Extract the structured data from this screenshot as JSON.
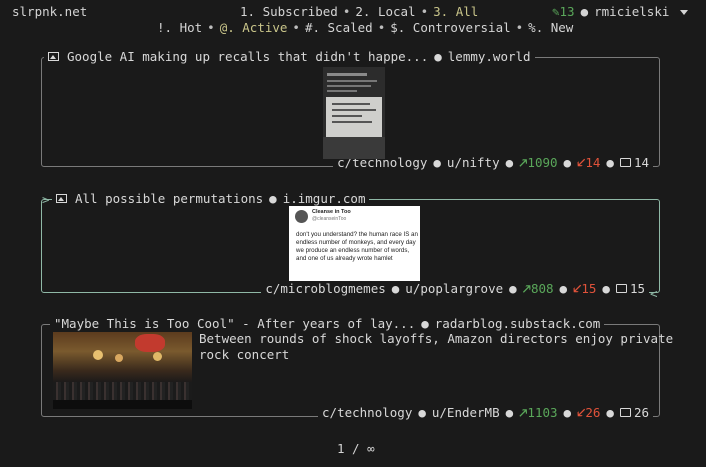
{
  "site": {
    "name": "slrpnk.net"
  },
  "listing_tabs": [
    {
      "label": "1. Subscribed",
      "active": false
    },
    {
      "label": "2. Local",
      "active": false
    },
    {
      "label": "3. All",
      "active": true
    }
  ],
  "sort_tabs": [
    {
      "label": "!. Hot",
      "active": false
    },
    {
      "label": "@. Active",
      "active": true
    },
    {
      "label": "#. Scaled",
      "active": false
    },
    {
      "label": "$. Controversial",
      "active": false
    },
    {
      "label": "%. New",
      "active": false
    }
  ],
  "user": {
    "score": "13",
    "username": "rmicielski",
    "dropdown_icon": "caret-down-icon"
  },
  "posts": [
    {
      "title": "Google AI making up recalls that didn't happe...",
      "domain": "lemmy.world",
      "type_icon": "image-icon",
      "community": "c/technology",
      "author": "u/nifty",
      "upvotes": "1090",
      "downvotes": "14",
      "comments": "14",
      "selected": false
    },
    {
      "title": "All possible permutations",
      "domain": "i.imgur.com",
      "type_icon": "image-icon",
      "community": "c/microblogmemes",
      "author": "u/poplargrove",
      "upvotes": "808",
      "downvotes": "15",
      "comments": "15",
      "selected": true,
      "thumbnail": {
        "name": "Cleanse in Too",
        "handle": "@cleanseinToo",
        "text": "don't you understand? the human race IS an endless number of monkeys, and every day we produce an endless number of words, and one of us already wrote hamlet"
      }
    },
    {
      "title": "\"Maybe This is Too Cool\" - After years of lay...",
      "domain": "radarblog.substack.com",
      "type_icon": "link-icon",
      "excerpt_line1": "Between rounds of shock layoffs, Amazon directors enjoy private",
      "excerpt_line2": "rock concert",
      "community": "c/technology",
      "author": "u/EnderMB",
      "upvotes": "1103",
      "downvotes": "26",
      "comments": "26",
      "selected": false
    }
  ],
  "pagination": {
    "label": "1 / ∞"
  },
  "colors": {
    "background": "#1a1a1a",
    "upvote": "#5aa75a",
    "downvote": "#e0523a",
    "active_tab": "#c9c58a",
    "selected_border": "#8fb8a6"
  }
}
